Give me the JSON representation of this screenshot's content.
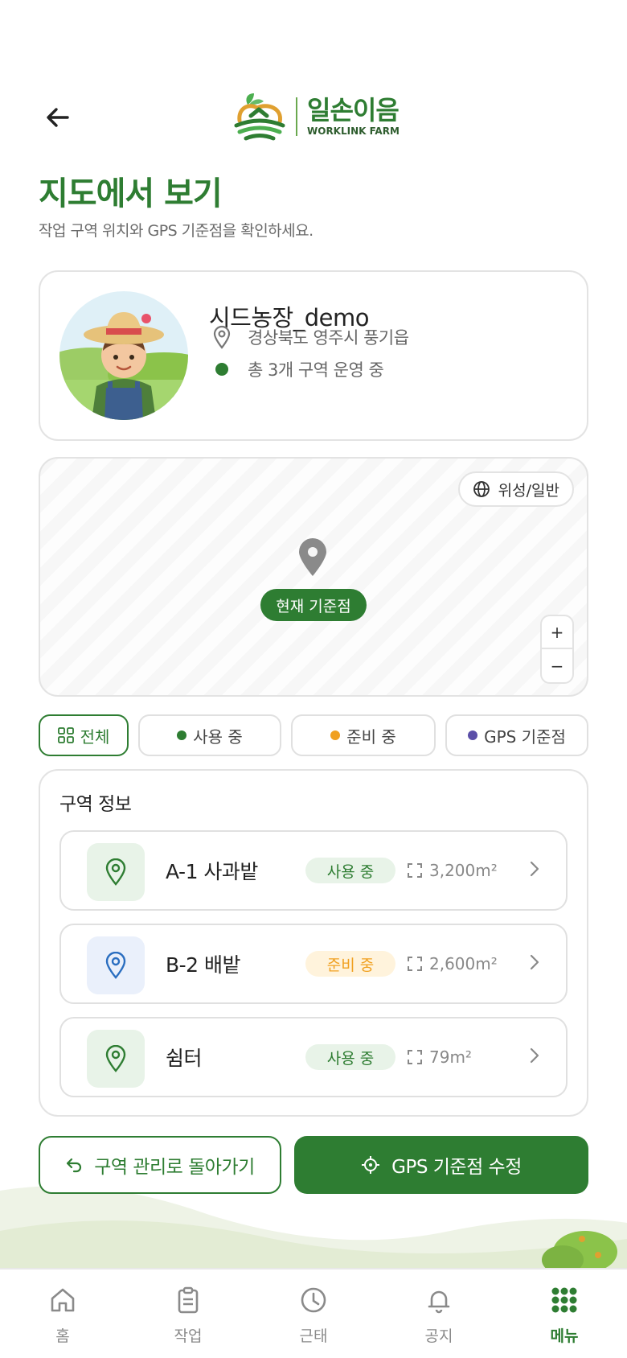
{
  "header": {
    "logo_main": "일손이음",
    "logo_sub": "WORKLINK FARM"
  },
  "page": {
    "title": "지도에서 보기",
    "subtitle": "작업 구역 위치와 GPS 기준점을 확인하세요."
  },
  "farm": {
    "name": "시드농장_demo",
    "location": "경상북도 영주시 풍기읍",
    "summary": "총 3개 구역 운영 중"
  },
  "map": {
    "toggle_label": "위성/일반",
    "pin_label": "현재 기준점",
    "zoom_in": "+",
    "zoom_out": "−"
  },
  "filters": [
    {
      "label": "전체",
      "active": true
    },
    {
      "label": "사용 중",
      "color": "#2e7d32"
    },
    {
      "label": "준비 중",
      "color": "#f0a020"
    },
    {
      "label": "GPS 기준점",
      "color": "#5b4fa8"
    }
  ],
  "zones": {
    "title": "구역 정보",
    "items": [
      {
        "name": "A-1 사과밭",
        "status": "사용 중",
        "area": "3,200m²",
        "icon": "map-pin-icon"
      },
      {
        "name": "B-2 배밭",
        "status": "준비 중",
        "area": "2,600m²",
        "icon": "map-pin-icon"
      },
      {
        "name": "쉼터",
        "status": "사용 중",
        "area": "79m²",
        "icon": "map-pin-icon"
      }
    ]
  },
  "actions": {
    "back_to_zones": "구역 관리로 돌아가기",
    "edit_gps": "GPS 기준점 수정"
  },
  "tabbar": [
    {
      "label": "홈",
      "icon": "home-icon"
    },
    {
      "label": "작업",
      "icon": "clipboard-icon"
    },
    {
      "label": "근태",
      "icon": "clock-icon"
    },
    {
      "label": "공지",
      "icon": "bell-icon"
    },
    {
      "label": "메뉴",
      "icon": "grid-icon",
      "active": true
    }
  ],
  "colors": {
    "brand": "#2e7d32",
    "in_use_bg": "#e8f3e8",
    "ready_bg": "#fff3dc",
    "ready_text": "#f0a020",
    "gps": "#5b4fa8"
  }
}
